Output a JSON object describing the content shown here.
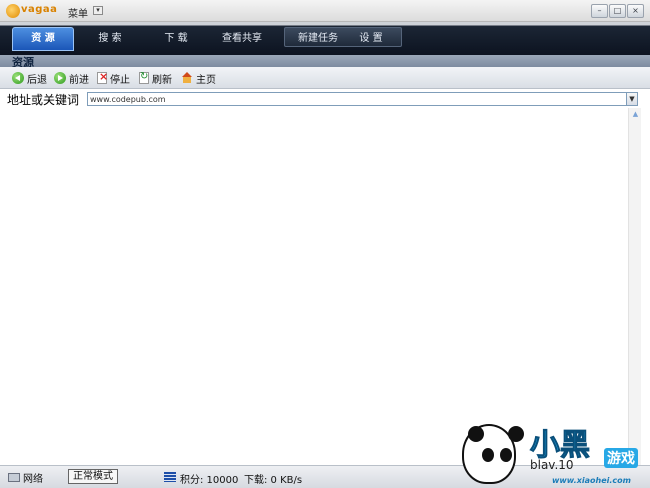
{
  "app": {
    "logo_text": "vagaa",
    "menu_label": "菜单"
  },
  "window_controls": {
    "minimize": "–",
    "maximize": "□",
    "close": "×"
  },
  "nav": {
    "tabs": [
      {
        "label": "资 源",
        "active": true
      },
      {
        "label": "搜 索",
        "active": false
      },
      {
        "label": "下 载",
        "active": false
      },
      {
        "label": "查看共享",
        "active": false
      },
      {
        "label": "新建任务",
        "active": false
      },
      {
        "label": "设 置",
        "active": false
      }
    ]
  },
  "section": {
    "title": "资源"
  },
  "toolbar": {
    "back": {
      "label": "后退",
      "icon": "back-arrow-icon"
    },
    "forward": {
      "label": "前进",
      "icon": "forward-arrow-icon"
    },
    "stop": {
      "label": "停止",
      "icon": "stop-icon"
    },
    "refresh": {
      "label": "刷新",
      "icon": "refresh-icon"
    },
    "home": {
      "label": "主页",
      "icon": "home-icon"
    }
  },
  "address": {
    "label": "地址或关键词",
    "value": "www.codepub.com"
  },
  "status": {
    "network": "网络",
    "mode": "正常模式",
    "score": "积分: 10000",
    "download": "下载: 0 KB/s"
  },
  "watermark": {
    "brand": "小黑",
    "sub": "游戏",
    "partial": "blav.10",
    "url": "www.xiaohei.com"
  },
  "colors": {
    "nav_active": "#1b56b8",
    "nav_bg": "#0c1320",
    "section_bg": "#7d8ba0"
  }
}
